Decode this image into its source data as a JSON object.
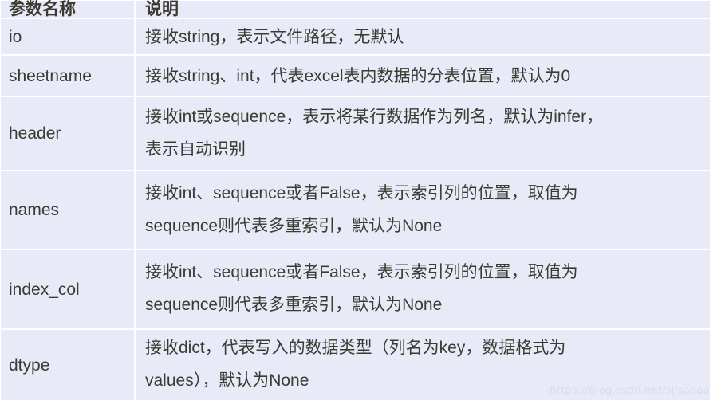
{
  "table": {
    "columns": [
      "参数名称",
      "说明"
    ],
    "rows": [
      {
        "name": "io",
        "lines": [
          "接收string，表示文件路径，无默认"
        ]
      },
      {
        "name": "sheetname",
        "lines": [
          "接收string、int，代表excel表内数据的分表位置，默认为0"
        ]
      },
      {
        "name": "header",
        "lines": [
          "接收int或sequence，表示将某行数据作为列名，默认为infer，",
          "表示自动识别"
        ]
      },
      {
        "name": "names",
        "lines": [
          "接收int、sequence或者False，表示索引列的位置，取值为",
          "sequence则代表多重索引，默认为None"
        ]
      },
      {
        "name": "index_col",
        "lines": [
          "接收int、sequence或者False，表示索引列的位置，取值为",
          "sequence则代表多重索引，默认为None"
        ]
      },
      {
        "name": "dtype",
        "lines": [
          "接收dict，代表写入的数据类型（列名为key，数据格式为",
          "values），默认为None"
        ]
      }
    ]
  },
  "watermark": {
    "text": "https://blog.csdn.net/sjjsaaaa"
  },
  "colors": {
    "cell_background": "#e8ebf7",
    "grid_line": "#ffffff",
    "text": "#3b3b33",
    "watermark": "#d6dcee"
  }
}
